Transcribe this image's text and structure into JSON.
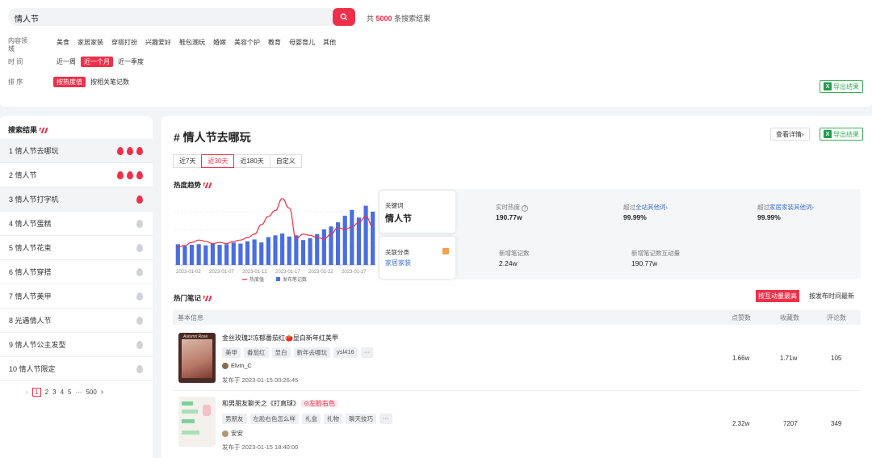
{
  "search": {
    "query": "情人节",
    "count_prefix": "共",
    "count": "5000",
    "count_suffix": "条搜索结果"
  },
  "filters": {
    "content_label": "内容领域",
    "content_options": [
      "美食",
      "家居家装",
      "穿搭打扮",
      "兴趣爱好",
      "鞋包潮玩",
      "婚嫁",
      "美容个护",
      "教育",
      "母婴育儿",
      "其他"
    ],
    "time_label": "时 间",
    "time_options": [
      "近一周",
      "近一个月",
      "近一季度"
    ],
    "sort_label": "排 序",
    "sort_options": [
      "按热度值",
      "按相关笔记数"
    ]
  },
  "export_label": "导出结果",
  "sidebar": {
    "title": "搜索结果",
    "items": [
      {
        "label": "1 情人节去哪玩",
        "heat": 3
      },
      {
        "label": "2 情人节",
        "heat": 3
      },
      {
        "label": "3 情人节打字机",
        "heat": 1
      },
      {
        "label": "4 情人节蛋糕",
        "heat": 0
      },
      {
        "label": "5 情人节花束",
        "heat": 0
      },
      {
        "label": "6 情人节穿搭",
        "heat": 0
      },
      {
        "label": "7 情人节美甲",
        "heat": 0
      },
      {
        "label": "8 光遇情人节",
        "heat": 0
      },
      {
        "label": "9 情人节公主发型",
        "heat": 0
      },
      {
        "label": "10 情人节限定",
        "heat": 0
      }
    ],
    "pager": [
      "1",
      "2",
      "3",
      "4",
      "5",
      "···",
      "500"
    ]
  },
  "main": {
    "title": "# 情人节去哪玩",
    "detail_label": "查看详情›",
    "tabs": [
      "近7天",
      "近30天",
      "近180天",
      "自定义"
    ],
    "trend_title": "热度趋势",
    "hot_title": "热门笔记"
  },
  "metrics": {
    "keyword_label": "关键词",
    "keyword": "情人节",
    "realtime_label": "实时热度",
    "realtime_value": "190.77w",
    "above_all_prefix": "超过",
    "above_all_link": "全站其他词›",
    "above_all_value": "99.99%",
    "above_cat_prefix": "超过",
    "above_cat_link": "家居家装其他词›",
    "above_cat_value": "99.99%",
    "category_label": "关联分类",
    "category": "家居家装",
    "new_notes_label": "新增笔记数",
    "new_notes_value": "2.24w",
    "interact_label": "新增笔记数互动量",
    "interact_value": "190.77w"
  },
  "notes_sort": [
    "按互动量最高",
    "按发布时间最新"
  ],
  "table_head": [
    "基本信息",
    "点赞数",
    "收藏数",
    "评论数"
  ],
  "notes": [
    {
      "title": "金丝玫瑰ℷ!冻郁番茄红🍅显白新年红美甲",
      "tags": [
        "美甲",
        "番茄红",
        "显白",
        "新年去哪玩",
        "ysl416",
        "···"
      ],
      "author": "Elvin_C",
      "published": "发布于 2023-01-15 00:26:45",
      "likes": "1.66w",
      "saves": "1.71w",
      "comments": "105"
    },
    {
      "title": "和男朋友聊天之《打直球》",
      "badge": "⊙左脸右色",
      "tags": [
        "男朋友",
        "左脸右色怎么样",
        "礼盒",
        "礼物",
        "聊天技巧",
        "···"
      ],
      "author": "安安",
      "published": "发布于 2023-01-15 18:40:00",
      "likes": "2.32w",
      "saves": "7207",
      "comments": "349"
    }
  ],
  "chart_data": {
    "type": "bar+line",
    "x_tick_labels": [
      "2023-01-02",
      "2023-01-07",
      "2023-01-12",
      "2023-01-17",
      "2023-01-22",
      "2023-01-27"
    ],
    "legend": [
      "热度值",
      "发布笔记数"
    ],
    "colors": {
      "line": "#f0304a",
      "bars": "#4a6ee0"
    },
    "bars": [
      35,
      32,
      34,
      35,
      33,
      36,
      34,
      35,
      38,
      36,
      40,
      43,
      38,
      47,
      50,
      53,
      48,
      50,
      42,
      45,
      52,
      60,
      65,
      72,
      83,
      93,
      80,
      100,
      90
    ],
    "line": [
      30,
      33,
      38,
      42,
      40,
      36,
      38,
      36,
      40,
      42,
      46,
      52,
      68,
      82,
      92,
      112,
      96,
      45,
      52,
      50,
      46,
      44,
      52,
      63,
      60,
      64,
      72,
      82,
      65
    ],
    "ylim": [
      0,
      120
    ]
  },
  "colors": {
    "accent": "#f0304a",
    "export": "#3cae5a",
    "link": "#3b6fd8"
  }
}
